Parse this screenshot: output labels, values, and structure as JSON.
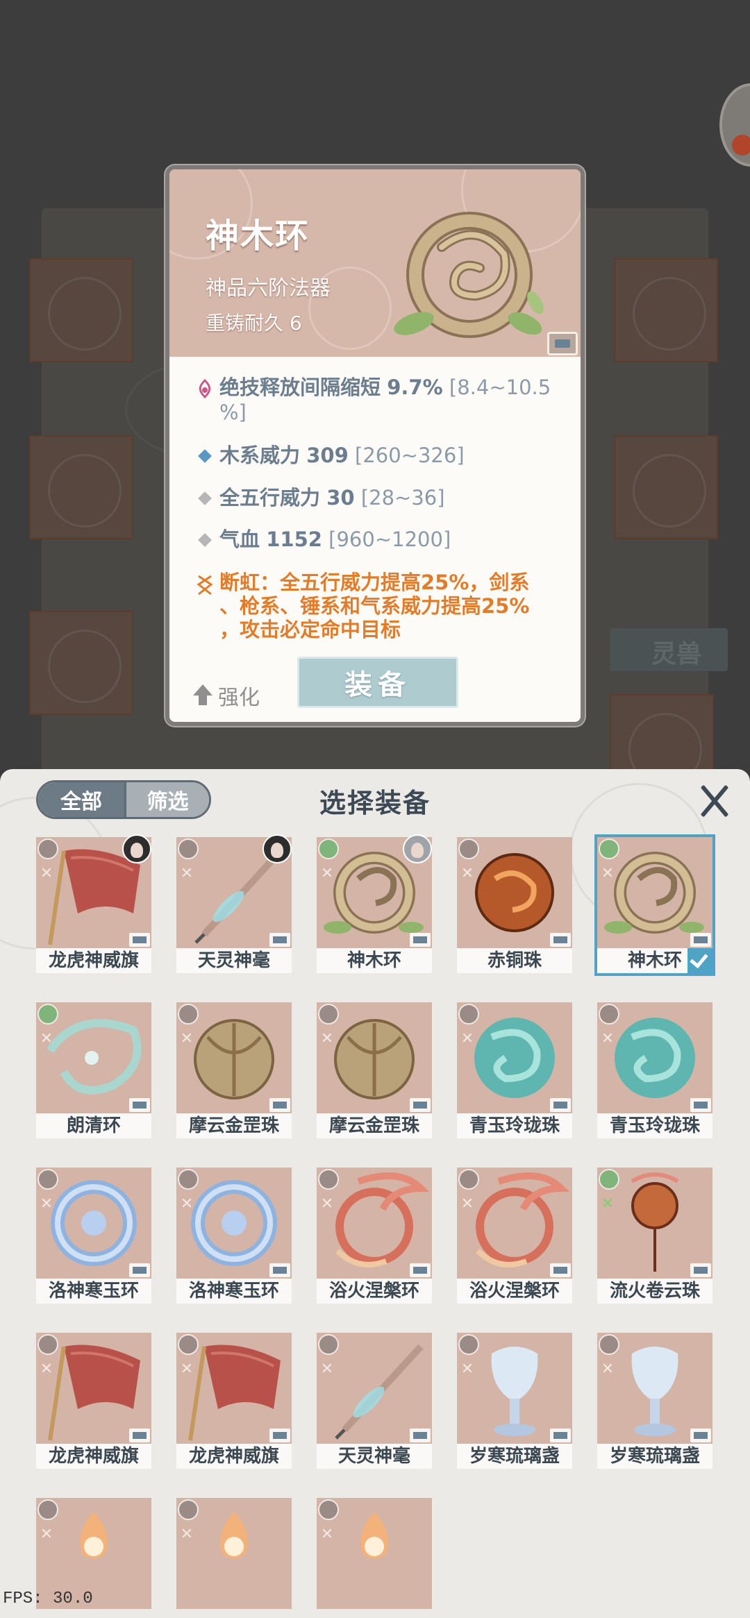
{
  "detail": {
    "name": "神木环",
    "grade": "神品六阶法器",
    "durability": "重铸耐久 6",
    "attributes": [
      {
        "icon": "skill-attr-icon",
        "name": "绝技释放间隔缩短",
        "value": "9.7%",
        "range_line1": "[8.4~10.5",
        "range_line2": "%]"
      },
      {
        "icon": "blue-diamond-icon",
        "name": "木系威力",
        "value": "309",
        "range": "[260~326]"
      },
      {
        "icon": "grey-diamond-icon",
        "name": "全五行威力",
        "value": "30",
        "range": "[28~36]"
      },
      {
        "icon": "grey-diamond-icon",
        "name": "气血",
        "value": "1152",
        "range": "[960~1200]"
      }
    ],
    "special": {
      "line1": "断虹：全五行威力提高25%，剑系",
      "line2": "、枪系、锤系和气系威力提高25%",
      "line3": "，攻击必定命中目标"
    },
    "enhance_label": "强化",
    "equip_label": "装备"
  },
  "panel": {
    "tab_all": "全部",
    "tab_filter": "筛选",
    "title": "选择装备",
    "items": [
      {
        "label": "龙虎神威旗",
        "art": "banner",
        "owner": "dark",
        "selected": false
      },
      {
        "label": "天灵神毫",
        "art": "brush",
        "owner": "dark",
        "selected": false
      },
      {
        "label": "神木环",
        "art": "wood-ring",
        "owner": "silver",
        "selected": false
      },
      {
        "label": "赤铜珠",
        "art": "copper-orb",
        "owner": "",
        "selected": false
      },
      {
        "label": "神木环",
        "art": "wood-ring",
        "owner": "",
        "selected": true
      },
      {
        "label": "朗清环",
        "art": "clear-ring",
        "owner": "",
        "selected": false
      },
      {
        "label": "摩云金罡珠",
        "art": "gold-orb",
        "owner": "",
        "selected": false
      },
      {
        "label": "摩云金罡珠",
        "art": "gold-orb",
        "owner": "",
        "selected": false
      },
      {
        "label": "青玉玲珑珠",
        "art": "jade-orb",
        "owner": "",
        "selected": false
      },
      {
        "label": "青玉玲珑珠",
        "art": "jade-orb",
        "owner": "",
        "selected": false
      },
      {
        "label": "洛神寒玉环",
        "art": "ice-ring",
        "owner": "",
        "selected": false
      },
      {
        "label": "洛神寒玉环",
        "art": "ice-ring",
        "owner": "",
        "selected": false
      },
      {
        "label": "浴火涅槃环",
        "art": "phoenix-ring",
        "owner": "",
        "selected": false
      },
      {
        "label": "浴火涅槃环",
        "art": "phoenix-ring",
        "owner": "",
        "selected": false
      },
      {
        "label": "流火卷云珠",
        "art": "fire-cloud-orb",
        "owner": "",
        "selected": false
      },
      {
        "label": "龙虎神威旗",
        "art": "banner",
        "owner": "",
        "selected": false
      },
      {
        "label": "龙虎神威旗",
        "art": "banner",
        "owner": "",
        "selected": false
      },
      {
        "label": "天灵神毫",
        "art": "brush",
        "owner": "",
        "selected": false
      },
      {
        "label": "岁寒琉璃盏",
        "art": "ice-cup",
        "owner": "",
        "selected": false
      },
      {
        "label": "岁寒琉璃盏",
        "art": "ice-cup",
        "owner": "",
        "selected": false
      },
      {
        "label": "",
        "art": "flame-cup",
        "owner": "",
        "selected": false
      },
      {
        "label": "",
        "art": "flame-cup",
        "owner": "",
        "selected": false
      },
      {
        "label": "",
        "art": "flame-cup",
        "owner": "",
        "selected": false
      }
    ]
  },
  "background": {
    "lingshou_label": "灵兽"
  },
  "fps": "FPS: 30.0"
}
